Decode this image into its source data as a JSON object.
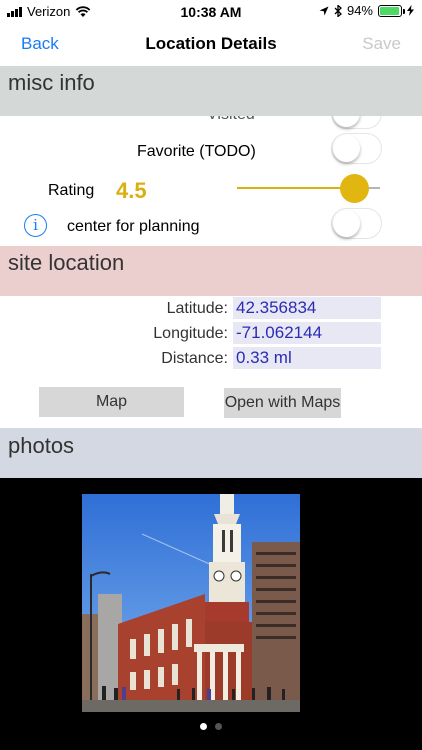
{
  "status_bar": {
    "carrier": "Verizon",
    "time": "10:38 AM",
    "battery_percent": "94%",
    "battery_level": 0.94,
    "battery_color": "#4cd964"
  },
  "nav": {
    "back_label": "Back",
    "title": "Location Details",
    "save_label": "Save"
  },
  "misc_info": {
    "header": "misc info",
    "visited_label": "Visited",
    "visited_on": false,
    "favorite_label": "Favorite (TODO)",
    "favorite_on": false,
    "rating_label": "Rating",
    "rating_value": "4.5",
    "rating_fraction": 0.83,
    "center_label": "center for planning",
    "center_on": false,
    "info_icon": "info-icon"
  },
  "site_location": {
    "header": "site location",
    "latitude_label": "Latitude:",
    "latitude_value": "42.356834",
    "longitude_label": "Longitude:",
    "longitude_value": "-71.062144",
    "distance_label": "Distance:",
    "distance_value": "0.33 ml",
    "map_button": "Map",
    "open_maps_button": "Open with Maps"
  },
  "photos": {
    "header": "photos",
    "page_count": 2,
    "current_page": 1
  },
  "colors": {
    "accent_blue": "#1a7cf5",
    "rating_gold": "#d9b00f",
    "value_text": "#2b2bb4"
  }
}
